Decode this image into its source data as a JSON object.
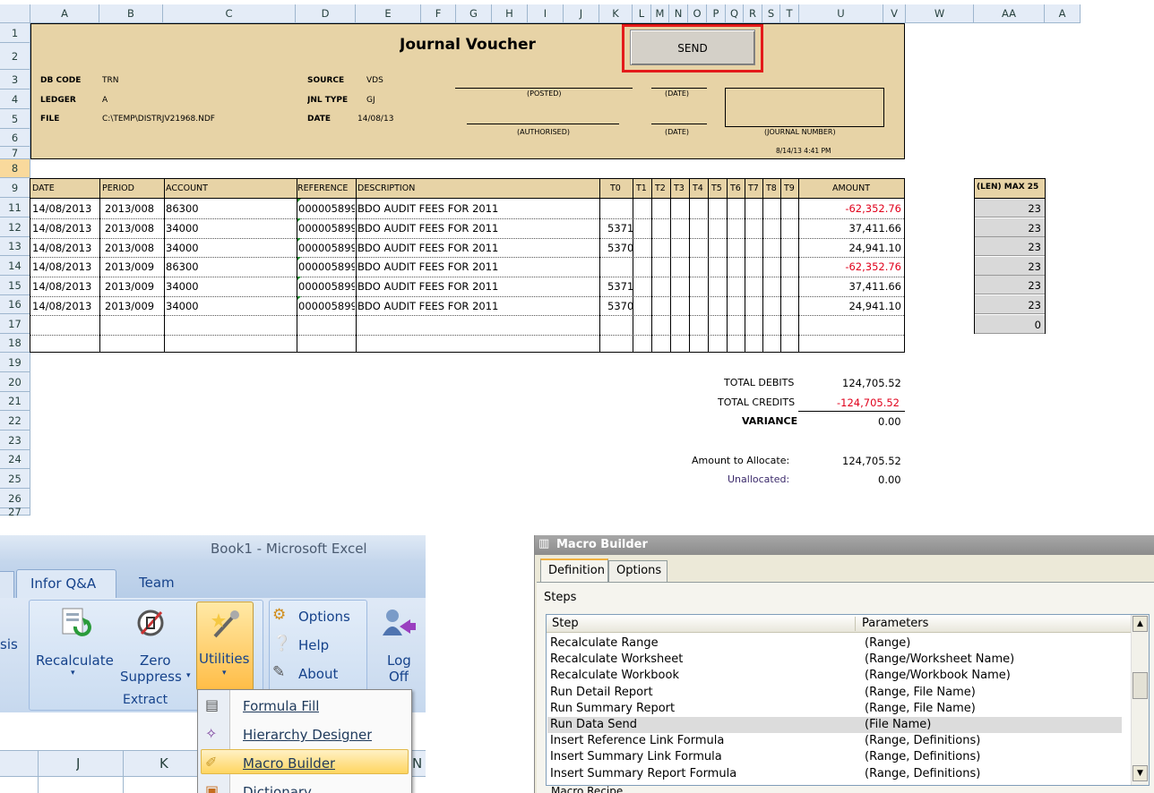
{
  "sheet": {
    "columns": [
      "A",
      "B",
      "C",
      "D",
      "E",
      "F",
      "G",
      "H",
      "I",
      "J",
      "K",
      "L",
      "M",
      "N",
      "O",
      "P",
      "Q",
      "R",
      "S",
      "T",
      "U",
      "V",
      "W",
      "AA",
      "A"
    ],
    "rows": [
      "1",
      "2",
      "3",
      "4",
      "5",
      "6",
      "7",
      "8",
      "9",
      "11",
      "12",
      "13",
      "14",
      "15",
      "16",
      "17",
      "18",
      "19",
      "20",
      "21",
      "22",
      "23",
      "24",
      "25",
      "26",
      "27"
    ],
    "title": "Journal Voucher",
    "send_label": "SEND",
    "header_fields": {
      "db_code_label": "DB CODE",
      "db_code": "TRN",
      "ledger_label": "LEDGER",
      "ledger": "A",
      "file_label": "FILE",
      "file": "C:\\TEMP\\DISTRJV21968.NDF",
      "source_label": "SOURCE",
      "source": "VDS",
      "jnl_type_label": "JNL TYPE",
      "jnl_type": "GJ",
      "date_label": "DATE",
      "date": "14/08/13"
    },
    "sign_labels": {
      "posted": "(POSTED)",
      "date1": "(DATE)",
      "authorised": "(AUTHORISED)",
      "date2": "(DATE)",
      "journal_number": "(JOURNAL NUMBER)"
    },
    "timestamp": "8/14/13 4:41 PM",
    "table_headers": [
      "DATE",
      "PERIOD",
      "ACCOUNT",
      "REFERENCE",
      "DESCRIPTION",
      "T0",
      "T1",
      "T2",
      "T3",
      "T4",
      "T5",
      "T6",
      "T7",
      "T8",
      "T9",
      "AMOUNT"
    ],
    "table_rows": [
      {
        "date": "14/08/2013",
        "period": "2013/008",
        "account": "86300",
        "reference": "000005899",
        "description": "BDO AUDIT FEES FOR 2011",
        "t0": "",
        "amount": "-62,352.76",
        "neg": true
      },
      {
        "date": "14/08/2013",
        "period": "2013/008",
        "account": "34000",
        "reference": "000005899",
        "description": "BDO AUDIT FEES FOR 2011",
        "t0": "5371",
        "amount": "37,411.66",
        "neg": false
      },
      {
        "date": "14/08/2013",
        "period": "2013/008",
        "account": "34000",
        "reference": "000005899",
        "description": "BDO AUDIT FEES FOR 2011",
        "t0": "5370",
        "amount": "24,941.10",
        "neg": false
      },
      {
        "date": "14/08/2013",
        "period": "2013/009",
        "account": "86300",
        "reference": "000005899",
        "description": "BDO AUDIT FEES FOR 2011",
        "t0": "",
        "amount": "-62,352.76",
        "neg": true
      },
      {
        "date": "14/08/2013",
        "period": "2013/009",
        "account": "34000",
        "reference": "000005899",
        "description": "BDO AUDIT FEES FOR 2011",
        "t0": "5371",
        "amount": "37,411.66",
        "neg": false
      },
      {
        "date": "14/08/2013",
        "period": "2013/009",
        "account": "34000",
        "reference": "000005899",
        "description": "BDO AUDIT FEES FOR 2011",
        "t0": "5370",
        "amount": "24,941.10",
        "neg": false
      }
    ],
    "len_header": "(LEN) MAX 25",
    "len_values": [
      "23",
      "23",
      "23",
      "23",
      "23",
      "23",
      "0"
    ],
    "totals": {
      "debits_label": "TOTAL DEBITS",
      "debits": "124,705.52",
      "credits_label": "TOTAL CREDITS",
      "credits": "-124,705.52",
      "variance_label": "VARIANCE",
      "variance": "0.00",
      "allocate_label": "Amount to Allocate:",
      "allocate": "124,705.52",
      "unallocated_label": "Unallocated:",
      "unallocated": "0.00"
    }
  },
  "ribbon": {
    "window_title": "Book1  -  Microsoft Excel",
    "tabs": [
      "Infor Q&A",
      "Team"
    ],
    "left_partial": "sis",
    "buttons": {
      "recalculate": "Recalculate",
      "zero": "Zero",
      "suppress": "Suppress",
      "utilities": "Utilities",
      "logoff_1": "Log",
      "logoff_2": "Off"
    },
    "small_buttons": [
      "Options",
      "Help",
      "About"
    ],
    "group_label": "Extract",
    "menu": [
      "Formula Fill",
      "Hierarchy Designer",
      "Macro Builder",
      "Dictionary"
    ],
    "grid_cols": [
      "J",
      "K",
      "N"
    ]
  },
  "macro": {
    "title": "Macro Builder",
    "tabs": [
      "Definition",
      "Options"
    ],
    "steps_label": "Steps",
    "col_step": "Step",
    "col_params": "Parameters",
    "rows": [
      {
        "step": "Recalculate Range",
        "params": "(Range)"
      },
      {
        "step": "Recalculate Worksheet",
        "params": "(Range/Worksheet Name)"
      },
      {
        "step": "Recalculate Workbook",
        "params": "(Range/Workbook Name)"
      },
      {
        "step": "Run Detail Report",
        "params": "(Range, File Name)"
      },
      {
        "step": "Run Summary Report",
        "params": "(Range, File Name)"
      },
      {
        "step": "Run Data Send",
        "params": "(File Name)"
      },
      {
        "step": "Insert Reference Link Formula",
        "params": "(Range, Definitions)"
      },
      {
        "step": "Insert Summary Link Formula",
        "params": "(Range, Definitions)"
      },
      {
        "step": "Insert Summary Report Formula",
        "params": "(Range, Definitions)"
      }
    ],
    "selected_index": 5,
    "bottom_label": "Macro Recipe"
  },
  "colors": {
    "voucher_bg": "#e7d3a6",
    "negative": "#e0001b",
    "send_outline": "#e31a1a",
    "menu_highlight": "#fbd874"
  }
}
